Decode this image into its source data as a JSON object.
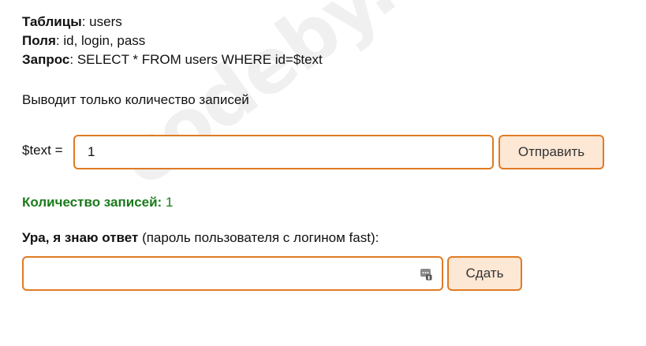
{
  "watermark": "codeby.net",
  "info": {
    "tables_label": "Таблицы",
    "tables_value": ": users",
    "fields_label": "Поля",
    "fields_value": ": id, login, pass",
    "query_label": "Запрос",
    "query_value": ": SELECT * FROM users WHERE id=$text"
  },
  "note": "Выводит только количество записей",
  "text_form": {
    "label": "$text =",
    "value": "1",
    "submit_label": "Отправить"
  },
  "result": {
    "label": "Количество записей:",
    "value": " 1"
  },
  "answer": {
    "prompt_bold": "Ура, я знаю ответ",
    "prompt_rest": " (пароль пользователя с логином fast):",
    "input_value": "",
    "icon": "password-manager-icon",
    "submit_label": "Сдать"
  },
  "colors": {
    "accent": "#e07b23",
    "button_bg": "#fde7d5",
    "result_green": "#1a7a1a"
  }
}
